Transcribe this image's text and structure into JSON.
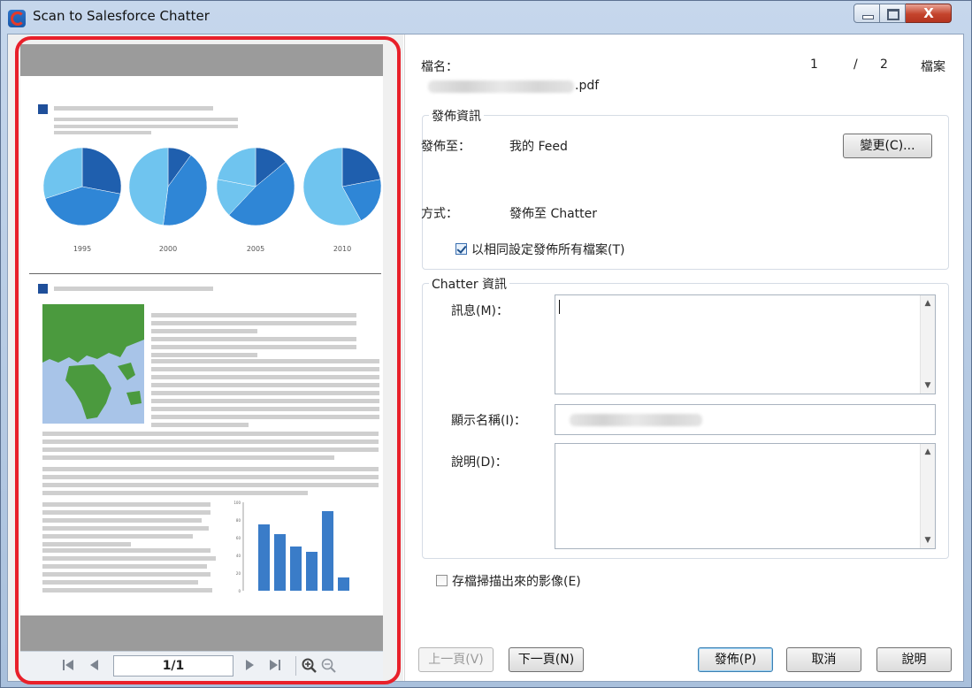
{
  "window": {
    "title": "Scan to Salesforce Chatter",
    "caption_buttons": {
      "minimize_icon": "minimize-icon",
      "maximize_icon": "maximize-icon",
      "close_glyph": "X"
    }
  },
  "file_info": {
    "label": "檔名：",
    "filename_suffix": ".pdf",
    "counter_current": "1",
    "counter_separator": "/",
    "counter_total": "2",
    "counter_unit": "檔案"
  },
  "publish_info": {
    "group_title": "發佈資訊",
    "post_to_label": "發佈至：",
    "post_to_value": "我的 Feed",
    "change_button": "變更(C)...",
    "method_label": "方式：",
    "method_value": "發佈至 Chatter",
    "same_settings_label": "以相同設定發佈所有檔案(T)",
    "same_settings_checked": true
  },
  "chatter_info": {
    "group_title": "Chatter 資訊",
    "message_label": "訊息(M)：",
    "message_value": "",
    "display_name_label": "顯示名稱(I)：",
    "description_label": "說明(D)：",
    "description_value": ""
  },
  "save_images": {
    "label": "存檔掃描出來的影像(E)",
    "checked": false
  },
  "footer": {
    "prev_page": "上一頁(V)",
    "next_page": "下一頁(N)",
    "publish": "發佈(P)",
    "cancel": "取消",
    "help": "說明"
  },
  "preview_nav": {
    "page_indicator": "1/1",
    "icons": [
      "first-page-icon",
      "prev-page-icon",
      "next-page-icon",
      "last-page-icon",
      "zoom-in-icon",
      "zoom-out-icon"
    ]
  },
  "document_preview": {
    "pie_years": [
      "1995",
      "2000",
      "2005",
      "2010"
    ],
    "bar_axis_ticks": [
      "100",
      "80",
      "60",
      "40",
      "20",
      "0"
    ],
    "bar_values": [
      75,
      64,
      50,
      44,
      90,
      15
    ],
    "colors": {
      "dark": "#1f5fae",
      "mid": "#2f86d6",
      "light": "#6fc4ef",
      "bar": "#3a7cc8"
    }
  }
}
